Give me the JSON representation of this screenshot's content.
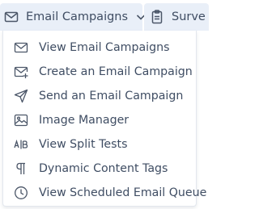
{
  "tabs": [
    {
      "label": "Email Campaigns",
      "icon": "envelope-icon",
      "open": true
    },
    {
      "label": "Surve",
      "icon": "clipboard-icon",
      "open": false
    }
  ],
  "menu": {
    "items": [
      {
        "label": "View Email Campaigns",
        "icon": "envelope-icon"
      },
      {
        "label": "Create an Email Campaign",
        "icon": "envelope-plus-icon"
      },
      {
        "label": "Send an Email Campaign",
        "icon": "paper-plane-icon"
      },
      {
        "label": "Image Manager",
        "icon": "image-icon"
      },
      {
        "label": "View Split Tests",
        "icon": "split-test-ab-icon"
      },
      {
        "label": "Dynamic Content Tags",
        "icon": "pilcrow-icon"
      },
      {
        "label": "View Scheduled Email Queue",
        "icon": "clock-icon"
      }
    ]
  },
  "colors": {
    "text": "#3f4d63",
    "tab_bg": "#e9eff8",
    "icon": "#4b5668"
  }
}
